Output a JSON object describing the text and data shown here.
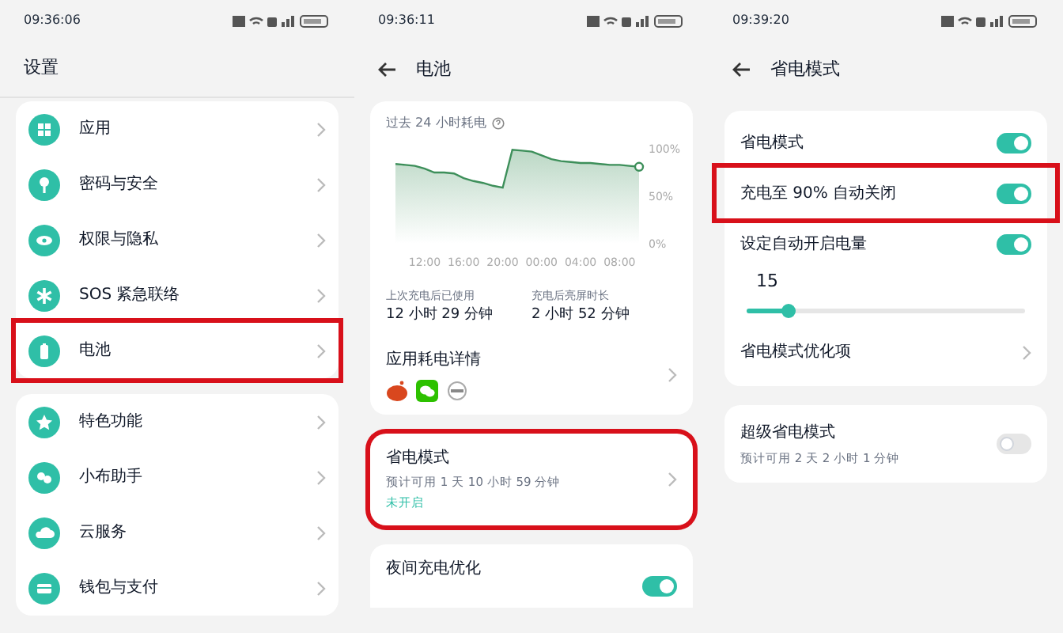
{
  "settings": {
    "status_time": "09:36:06",
    "title": "设置",
    "groups": [
      [
        {
          "label": "应用",
          "highlighted": false
        },
        {
          "label": "密码与安全",
          "highlighted": false
        },
        {
          "label": "权限与隐私",
          "highlighted": false
        },
        {
          "label": "SOS 紧急联络",
          "highlighted": false
        },
        {
          "label": "电池",
          "highlighted": true
        }
      ],
      [
        {
          "label": "特色功能",
          "highlighted": false
        },
        {
          "label": "小布助手",
          "highlighted": false
        },
        {
          "label": "云服务",
          "highlighted": false
        },
        {
          "label": "钱包与支付",
          "highlighted": false
        }
      ]
    ]
  },
  "battery": {
    "status_time": "09:36:11",
    "title": "电池",
    "usage_title": "过去 24 小时耗电",
    "chart_data": {
      "type": "area",
      "categories": [
        null,
        null,
        null,
        "12:00",
        null,
        null,
        null,
        "16:00",
        null,
        null,
        null,
        "20:00",
        null,
        null,
        null,
        "00:00",
        null,
        null,
        null,
        "04:00",
        null,
        null,
        null,
        "08:00",
        null,
        null
      ],
      "series": [
        {
          "color": "#3d8f5a",
          "values": [
            84,
            83,
            82,
            79,
            75,
            75,
            74,
            69,
            66,
            64,
            61,
            59,
            99,
            98,
            97,
            93,
            89,
            87,
            86,
            85,
            85,
            84,
            83,
            83,
            82,
            81
          ]
        }
      ],
      "yticks": [
        {
          "value": 0,
          "label": "0%"
        },
        {
          "value": 50,
          "label": "50%"
        },
        {
          "value": 100,
          "label": "100%"
        }
      ],
      "ylim": [
        0,
        100
      ]
    },
    "stats": [
      {
        "label": "上次充电后已使用",
        "value": "12 小时 29 分钟"
      },
      {
        "label": "充电后亮屏时长",
        "value": "2 小时 52 分钟"
      }
    ],
    "app_usage_title": "应用耗电详情",
    "power_saving": {
      "title": "省电模式",
      "subtitle": "预计可用 1 天 10 小时 59 分钟",
      "state": "未开启",
      "highlighted": true
    },
    "night_charging": {
      "title": "夜间充电优化",
      "on": true
    }
  },
  "power_mode": {
    "status_time": "09:39:20",
    "title": "省电模式",
    "rows": [
      {
        "kind": "toggle",
        "label": "省电模式",
        "on": true,
        "highlighted": false
      },
      {
        "kind": "toggle",
        "label": "充电至 90% 自动关闭",
        "on": true,
        "highlighted": true
      },
      {
        "kind": "toggle",
        "label": "设定自动开启电量",
        "on": true,
        "highlighted": false
      },
      {
        "kind": "slider",
        "value": "15",
        "level": 0.15
      },
      {
        "kind": "link",
        "label": "省电模式优化项"
      }
    ],
    "super": {
      "title": "超级省电模式",
      "subtitle": "预计可用 2 天 2 小时 1 分钟",
      "on": false
    }
  }
}
